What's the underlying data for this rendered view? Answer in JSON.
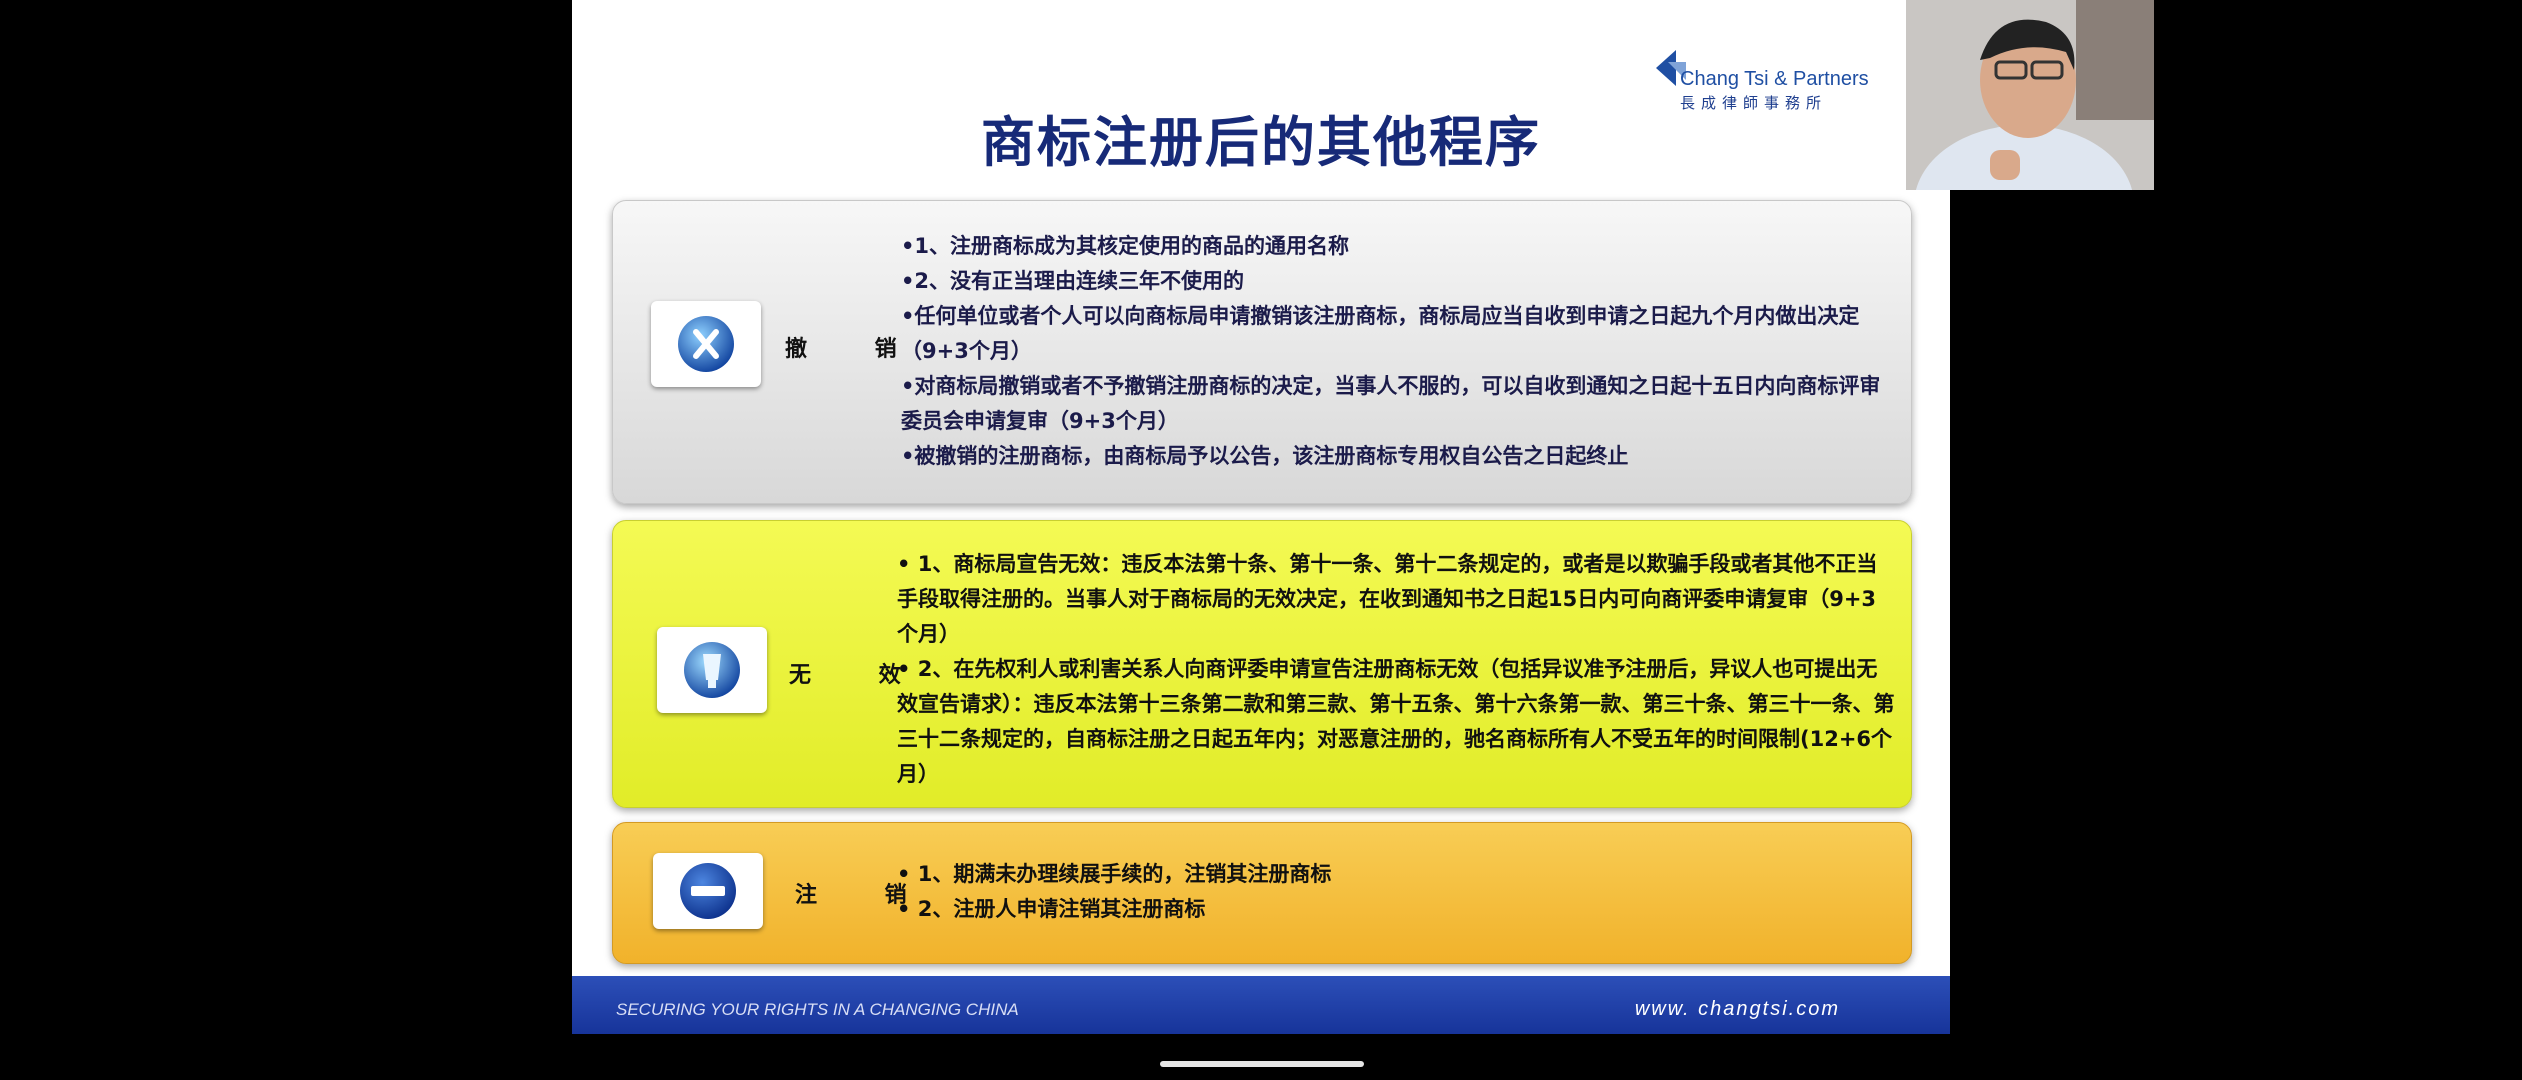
{
  "slide": {
    "title": "商标注册后的其他程序",
    "logo": {
      "name": "Chang Tsi & Partners",
      "chinese": "長成律師事務所"
    },
    "sections": [
      {
        "label": "撤 销",
        "icon": "blue-x-circle-icon",
        "items": [
          "•1、注册商标成为其核定使用的商品的通用名称",
          "•2、没有正当理由连续三年不使用的",
          "•任何单位或者个人可以向商标局申请撤销该注册商标，商标局应当自收到申请之日起九个月内做出决定（9+3个月）",
          "•对商标局撤销或者不予撤销注册商标的决定，当事人不服的，可以自收到通知之日起十五日内向商标评审委员会申请复审（9+3个月）",
          "•被撤销的注册商标，由商标局予以公告，该注册商标专用权自公告之日起终止"
        ]
      },
      {
        "label": "无 效",
        "icon": "blue-glass-circle-icon",
        "items": [
          "• 1、商标局宣告无效：违反本法第十条、第十一条、第十二条规定的，或者是以欺骗手段或者其他不正当手段取得注册的。当事人对于商标局的无效决定，在收到通知书之日起15日内可向商评委申请复审（9+3个月）",
          "• 2、在先权利人或利害关系人向商评委申请宣告注册商标无效（包括异议准予注册后，异议人也可提出无效宣告请求）：违反本法第十三条第二款和第三款、第十五条、第十六条第一款、第三十条、第三十一条、第三十二条规定的，自商标注册之日起五年内；对恶意注册的，驰名商标所有人不受五年的时间限制(12+6个月）"
        ]
      },
      {
        "label": "注 销",
        "icon": "no-entry-icon",
        "items": [
          "• 1、期满未办理续展手续的，注销其注册商标",
          "• 2、注册人申请注销其注册商标"
        ]
      }
    ],
    "footer": {
      "tagline": "SECURING YOUR RIGHTS IN A CHANGING CHINA",
      "website": "www. changtsi.com"
    }
  },
  "colors": {
    "title": "#172a78",
    "box_revoke": "#e6e6e6",
    "box_invalid": "#eaf23a",
    "box_cancel": "#f3bb38",
    "footer": "#1f3fa8"
  }
}
